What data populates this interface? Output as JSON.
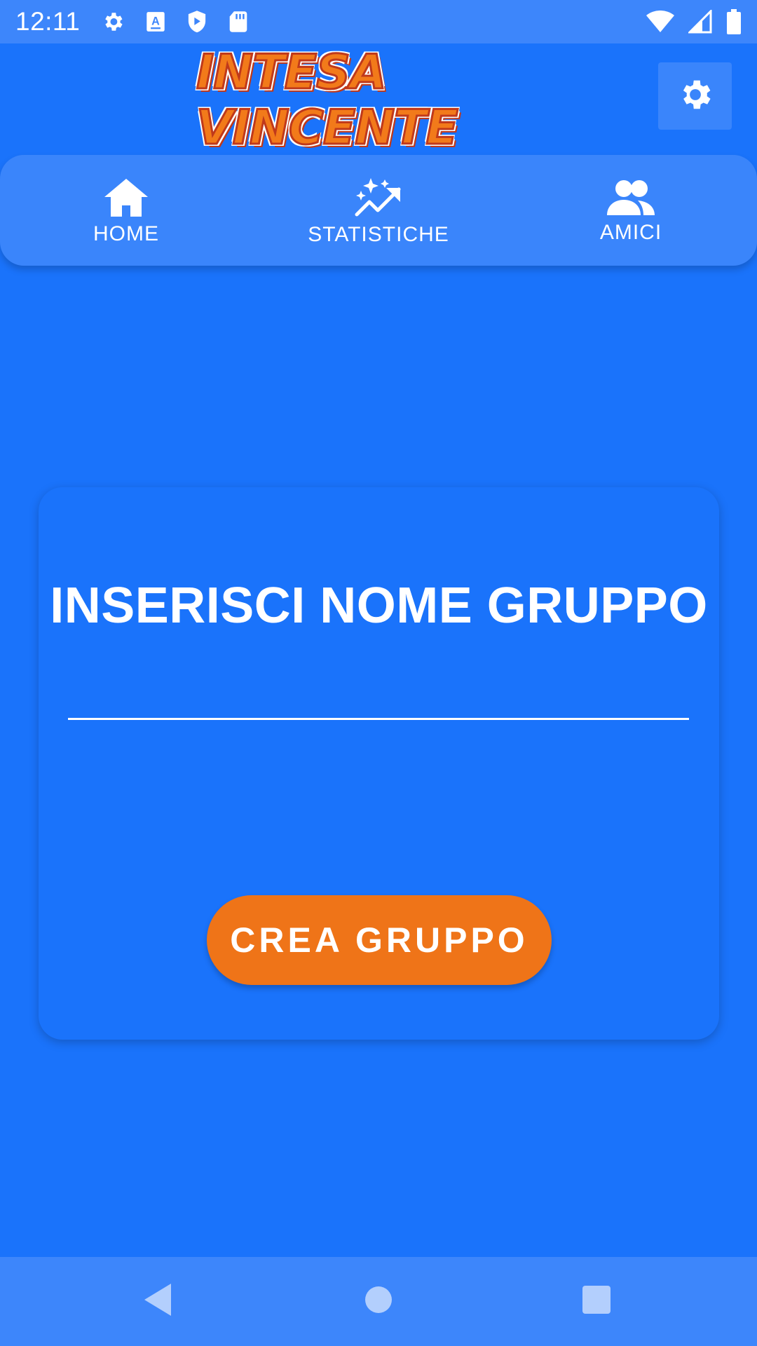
{
  "status_bar": {
    "time": "12:11",
    "left_icons": [
      "settings-icon",
      "keyboard-a-icon",
      "play-protect-icon",
      "sd-card-icon"
    ],
    "right_icons": [
      "wifi-icon",
      "signal-icon",
      "battery-icon"
    ]
  },
  "header": {
    "logo_text": "INTESA VINCENTE",
    "settings_icon": "gear-icon"
  },
  "nav": {
    "tabs": [
      {
        "label": "HOME",
        "icon": "home-icon"
      },
      {
        "label": "STATISTICHE",
        "icon": "trending-sparkle-icon"
      },
      {
        "label": "AMICI",
        "icon": "people-icon"
      }
    ]
  },
  "form": {
    "title": "INSERISCI NOME GRUPPO",
    "input_value": "",
    "button_label": "CREA GRUPPO"
  },
  "system_nav": {
    "buttons": [
      "back-icon",
      "home-circle-icon",
      "recents-icon"
    ]
  },
  "colors": {
    "background": "#1a73fb",
    "bar": "#3d86fb",
    "accent": "#ef7418",
    "text": "#ffffff"
  }
}
